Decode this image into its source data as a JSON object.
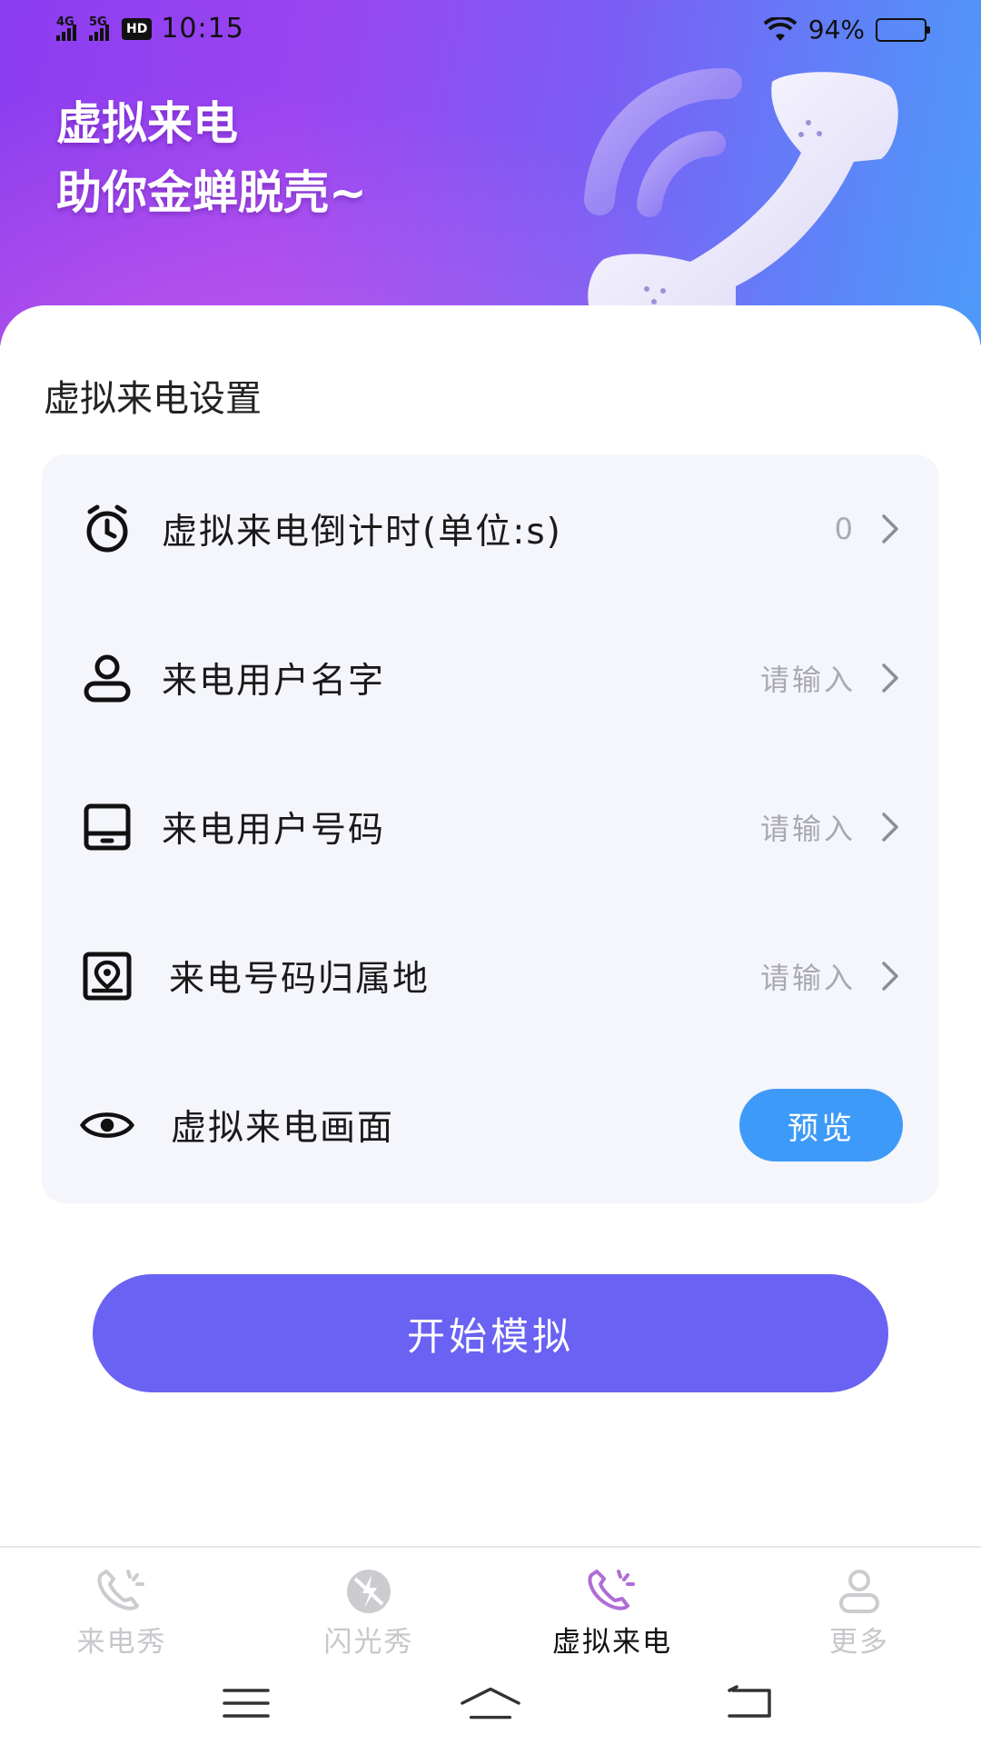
{
  "status_bar": {
    "network1": "4G",
    "network2": "5G",
    "hd": "HD",
    "time": "10:15",
    "battery_text": "94%",
    "battery_level": 0.94
  },
  "banner": {
    "line1": "虚拟来电",
    "line2": "助你金蝉脱壳~"
  },
  "settings": {
    "title": "虚拟来电设置",
    "rows": [
      {
        "icon": "stopwatch-icon",
        "label": "虚拟来电倒计时(单位:s)",
        "value": "0"
      },
      {
        "icon": "user-icon",
        "label": "来电用户名字",
        "value": "请输入"
      },
      {
        "icon": "phone-device-icon",
        "label": "来电用户号码",
        "value": "请输入"
      },
      {
        "icon": "location-pin-icon",
        "label": "来电号码归属地",
        "value": "请输入"
      },
      {
        "icon": "eye-icon",
        "label": "虚拟来电画面",
        "button": "预览"
      }
    ]
  },
  "start_button": "开始模拟",
  "tabbar": {
    "tabs": [
      {
        "label": "来电秀",
        "icon": "call-show-icon",
        "active": false
      },
      {
        "label": "闪光秀",
        "icon": "flash-icon",
        "active": false
      },
      {
        "label": "虚拟来电",
        "icon": "virtual-call-icon",
        "active": true
      },
      {
        "label": "更多",
        "icon": "more-user-icon",
        "active": false
      }
    ]
  },
  "colors": {
    "accent": "#6a62f2",
    "preview": "#3e9af8",
    "active_tab_icon": "#b06cd6",
    "inactive": "#c7c7cc"
  }
}
